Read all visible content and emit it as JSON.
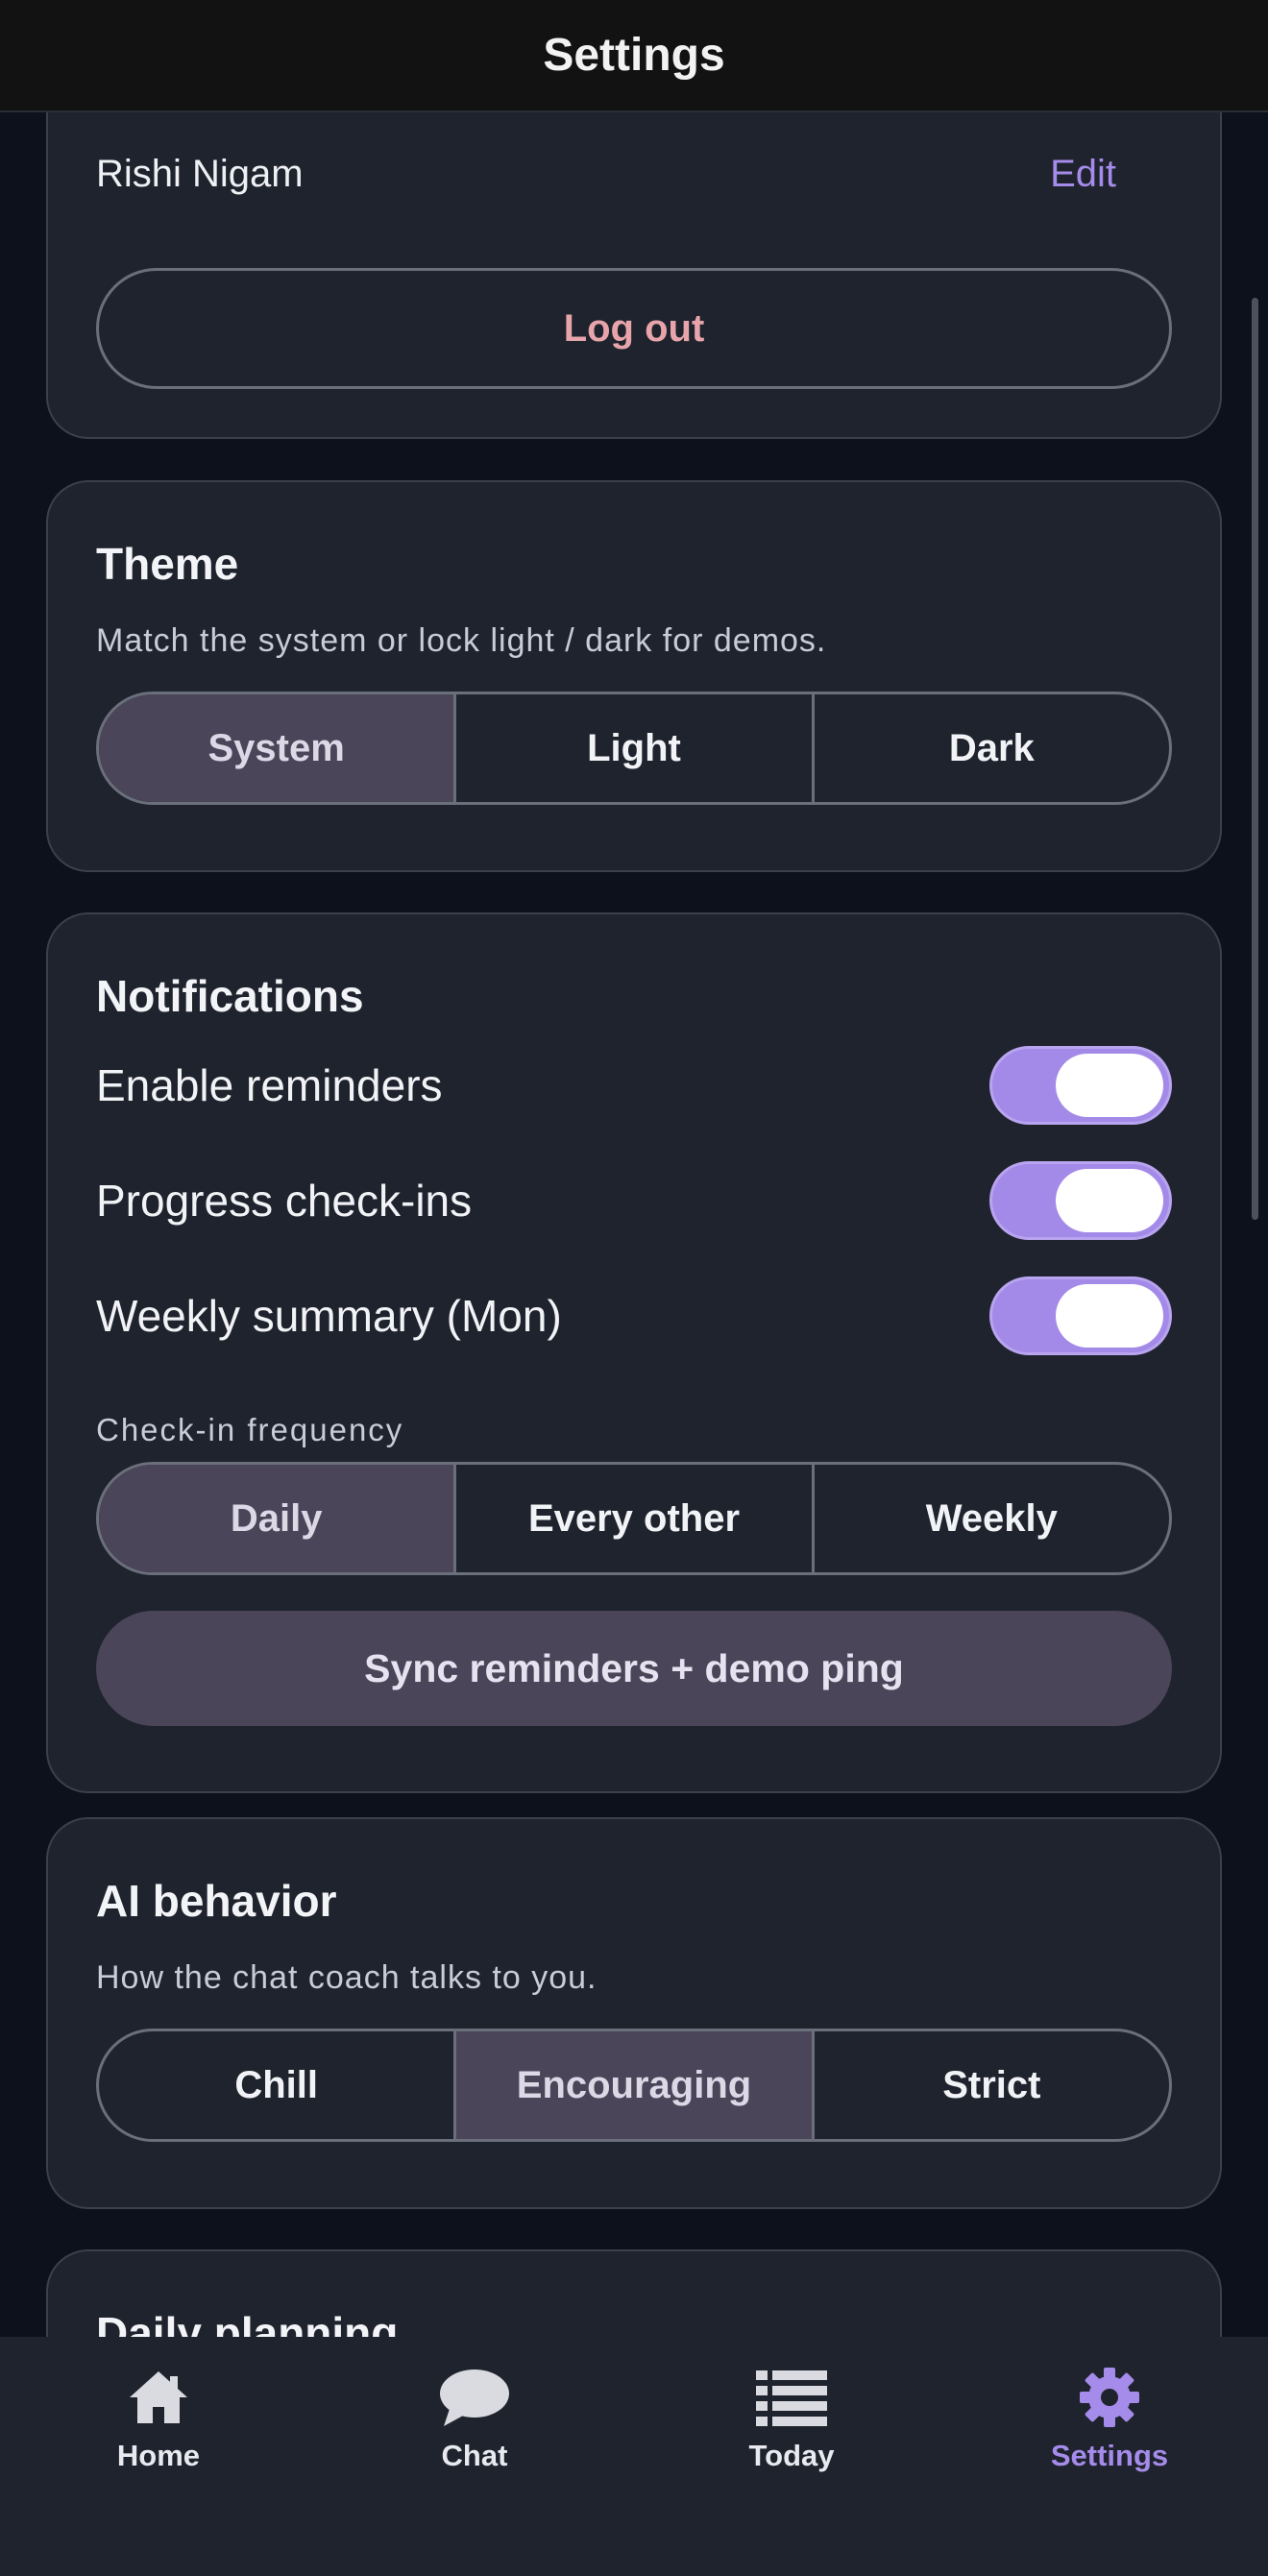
{
  "header": {
    "title": "Settings"
  },
  "account": {
    "name": "Rishi Nigam",
    "edit_label": "Edit",
    "logout_label": "Log out"
  },
  "theme": {
    "title": "Theme",
    "subtitle": "Match the system or lock light / dark for demos.",
    "options": [
      "System",
      "Light",
      "Dark"
    ],
    "selected": "System"
  },
  "notifications": {
    "title": "Notifications",
    "toggles": [
      {
        "label": "Enable reminders",
        "on": true
      },
      {
        "label": "Progress check-ins",
        "on": true
      },
      {
        "label": "Weekly summary (Mon)",
        "on": true
      }
    ],
    "frequency_label": "Check-in frequency",
    "frequency_options": [
      "Daily",
      "Every other",
      "Weekly"
    ],
    "frequency_selected": "Daily",
    "sync_label": "Sync reminders + demo ping"
  },
  "ai": {
    "title": "AI behavior",
    "subtitle": "How the chat coach talks to you.",
    "options": [
      "Chill",
      "Encouraging",
      "Strict"
    ],
    "selected": "Encouraging"
  },
  "daily": {
    "title": "Daily planning"
  },
  "tabs": [
    {
      "label": "Home",
      "icon": "home-icon"
    },
    {
      "label": "Chat",
      "icon": "chat-bubble-icon"
    },
    {
      "label": "Today",
      "icon": "list-icon"
    },
    {
      "label": "Settings",
      "icon": "gear-icon",
      "active": true
    }
  ],
  "colors": {
    "accent": "#a58bea",
    "logout": "#e7a4aa",
    "selected_segment": "#4a4558",
    "toggle_on": "#a48ae8"
  }
}
